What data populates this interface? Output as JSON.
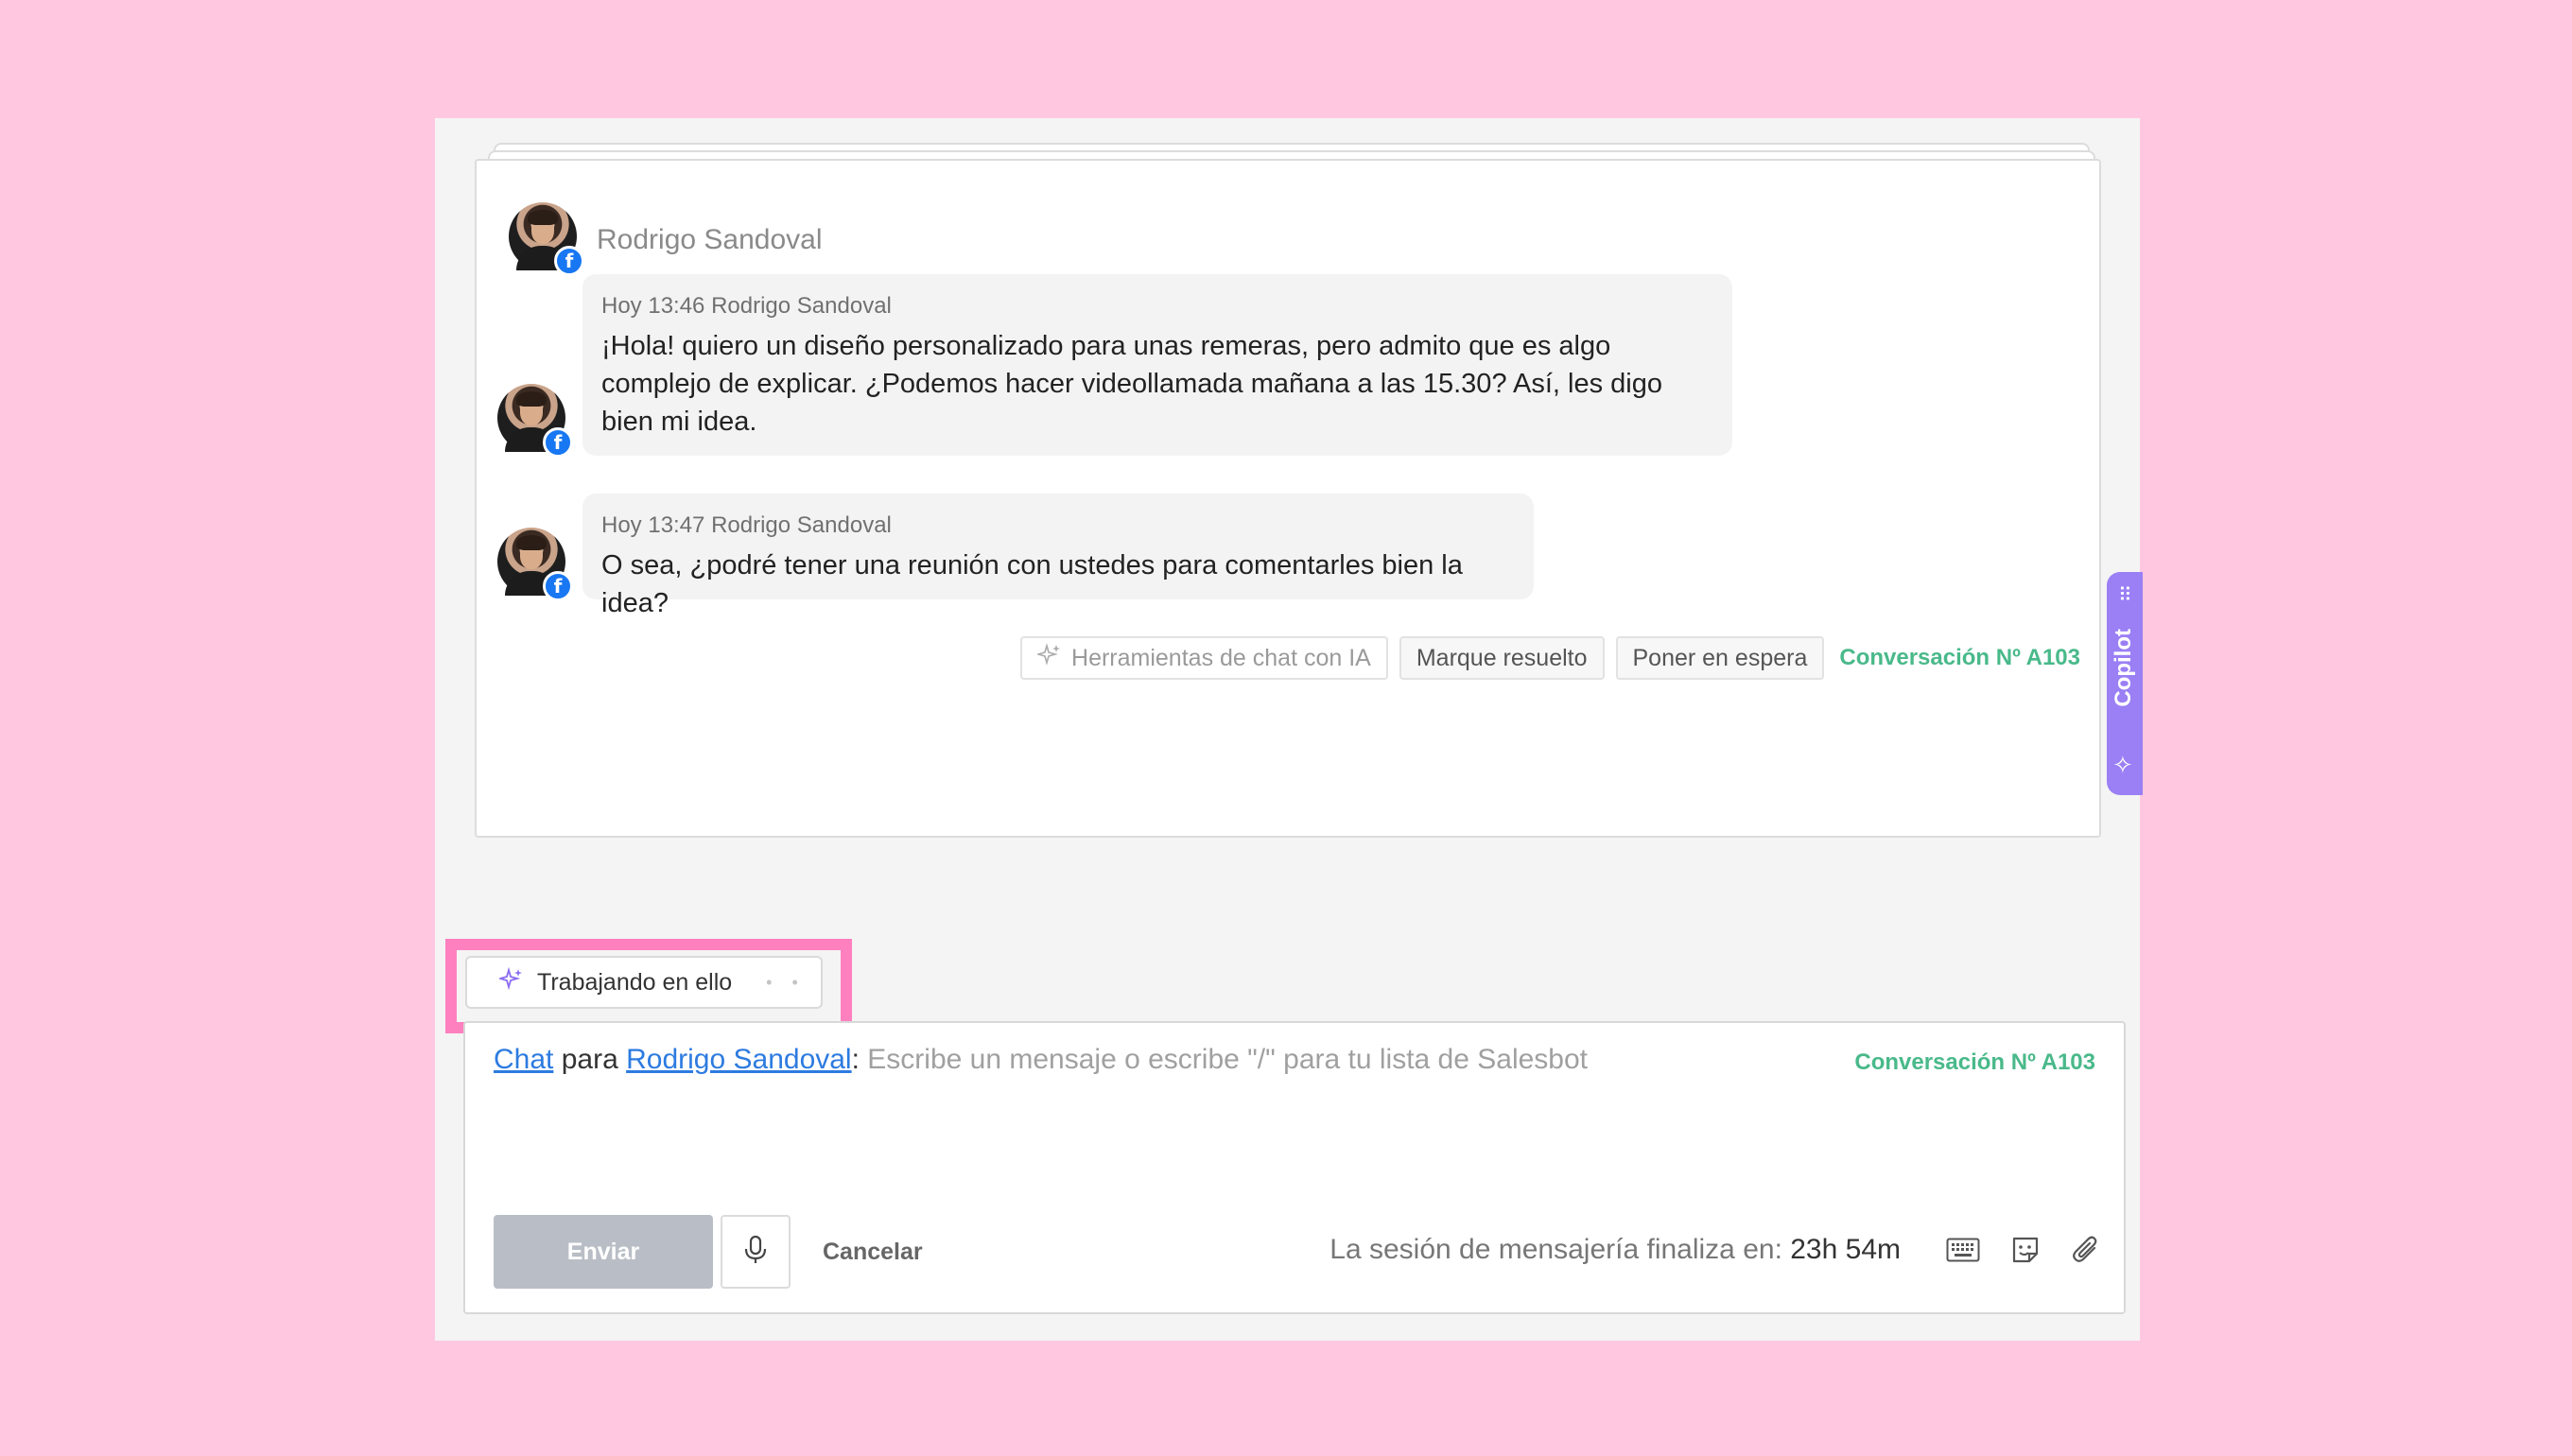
{
  "thread": {
    "header_name": "Rodrigo Sandoval",
    "messages": [
      {
        "meta": "Hoy 13:46 Rodrigo Sandoval",
        "text": "¡Hola! quiero un diseño personalizado para unas remeras, pero admito que es algo complejo de explicar. ¿Podemos hacer videollamada mañana a las 15.30? Así, les digo bien mi idea."
      },
      {
        "meta": "Hoy 13:47 Rodrigo Sandoval",
        "text": "O sea, ¿podré tener una reunión con ustedes para comentarles bien la idea?"
      }
    ],
    "source_badge": "f"
  },
  "toolbar": {
    "ai_tools_label": "Herramientas de chat con IA",
    "resolve_label": "Marque resuelto",
    "hold_label": "Poner en espera",
    "conversation_id": "Conversación Nº A103"
  },
  "copilot": {
    "label": "Copilot"
  },
  "working_chip": {
    "label": "Trabajando en ello",
    "dots": "• •"
  },
  "composer": {
    "channel_link": "Chat",
    "for_word": "para",
    "recipient_link": "Rodrigo Sandoval",
    "separator": ":",
    "placeholder": "Escribe un mensaje o escribe \"/\" para tu lista de Salesbot",
    "conversation_id": "Conversación Nº A103",
    "send_label": "Enviar",
    "cancel_label": "Cancelar",
    "session_label": "La sesión de mensajería finaliza en:",
    "session_time": "23h 54m"
  },
  "colors": {
    "background": "#ffc8e0",
    "highlight": "#ff80bf",
    "accent_green": "#49b98a",
    "link_blue": "#2d7be0",
    "copilot_purple": "#9a7ff5",
    "facebook_blue": "#1877f2"
  },
  "icons": [
    "facebook-icon",
    "sparkle-icon",
    "microphone-icon",
    "keyboard-icon",
    "sticker-icon",
    "paperclip-icon",
    "drag-handle-icon"
  ]
}
